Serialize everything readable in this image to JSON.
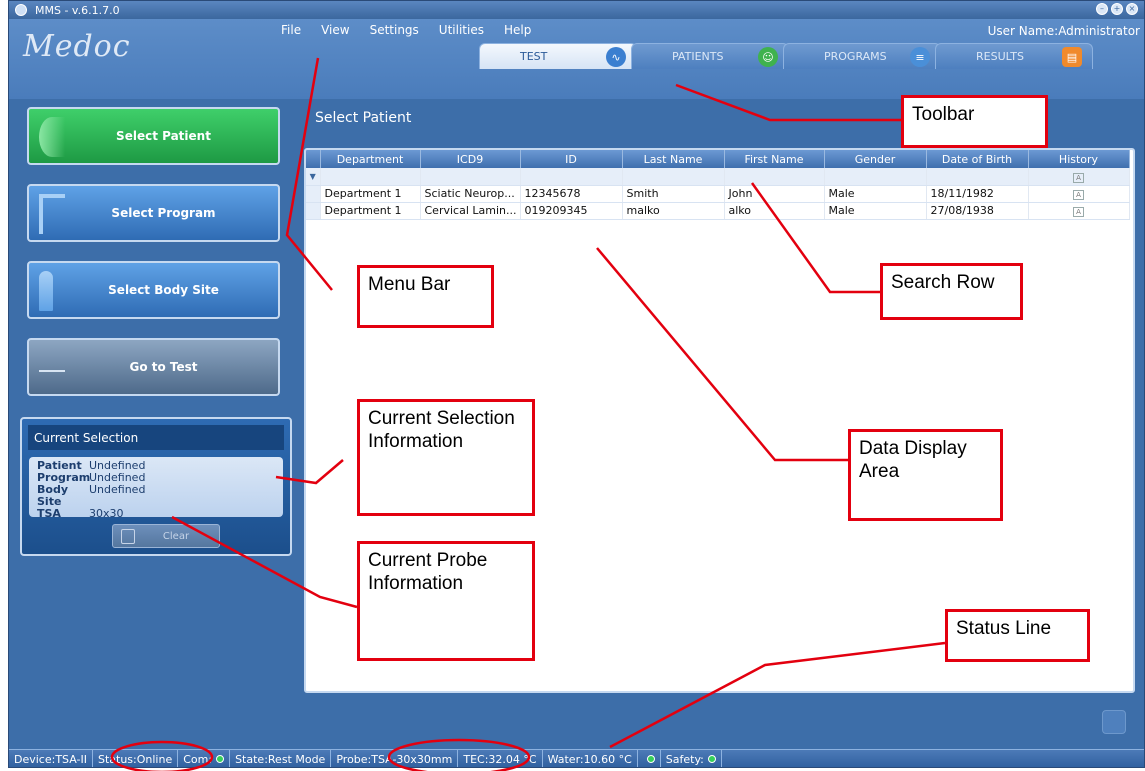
{
  "window": {
    "title": "MMS - v.6.1.7.0"
  },
  "logo": "Medoc",
  "menu": [
    "File",
    "View",
    "Settings",
    "Utilities",
    "Help"
  ],
  "user": {
    "label": "User Name:",
    "name": "Administrator"
  },
  "tabs": [
    "TEST",
    "PATIENTS",
    "PROGRAMS",
    "RESULTS"
  ],
  "sidebar": {
    "select_patient": "Select Patient",
    "select_program": "Select Program",
    "select_body_site": "Select Body Site",
    "go_to_test": "Go to Test"
  },
  "current_selection": {
    "title": "Current Selection",
    "rows": [
      {
        "key": "Patient",
        "value": "Undefined"
      },
      {
        "key": "Program",
        "value": "Undefined"
      },
      {
        "key": "Body Site",
        "value": "Undefined"
      },
      {
        "key": "TSA",
        "value": "30x30"
      }
    ],
    "clear_label": "Clear"
  },
  "main": {
    "title": "Select Patient",
    "columns": [
      "Department",
      "ICD9",
      "ID",
      "Last Name",
      "First Name",
      "Gender",
      "Date of Birth",
      "History"
    ],
    "rows": [
      [
        "Department 1",
        "Sciatic Neurop...",
        "12345678",
        "Smith",
        "John",
        "Male",
        "18/11/1982"
      ],
      [
        "Department 1",
        "Cervical Lamin...",
        "019209345",
        "malko",
        "alko",
        "Male",
        "27/08/1938"
      ]
    ],
    "filter_icon": "filter-icon"
  },
  "status": {
    "device": "Device:TSA-II",
    "status": "Status:Online",
    "com": "Com:",
    "state": "State:Rest Mode",
    "probe": "Probe:TSA-30x30mm",
    "tec": "TEC:32.04 °C",
    "water": "Water:10.60 °C",
    "safety": "Safety:"
  },
  "annotations": {
    "toolbar": "Toolbar",
    "menu_bar": "Menu Bar",
    "search_row": "Search Row",
    "current_selection_info": "Current Selection Information",
    "data_display_area": "Data Display Area",
    "current_probe_info": "Current Probe Information",
    "status_line": "Status Line"
  },
  "colors": {
    "accent_red": "#e3000f",
    "app_blue": "#3d6ea9",
    "active_green": "#2fae4f"
  }
}
